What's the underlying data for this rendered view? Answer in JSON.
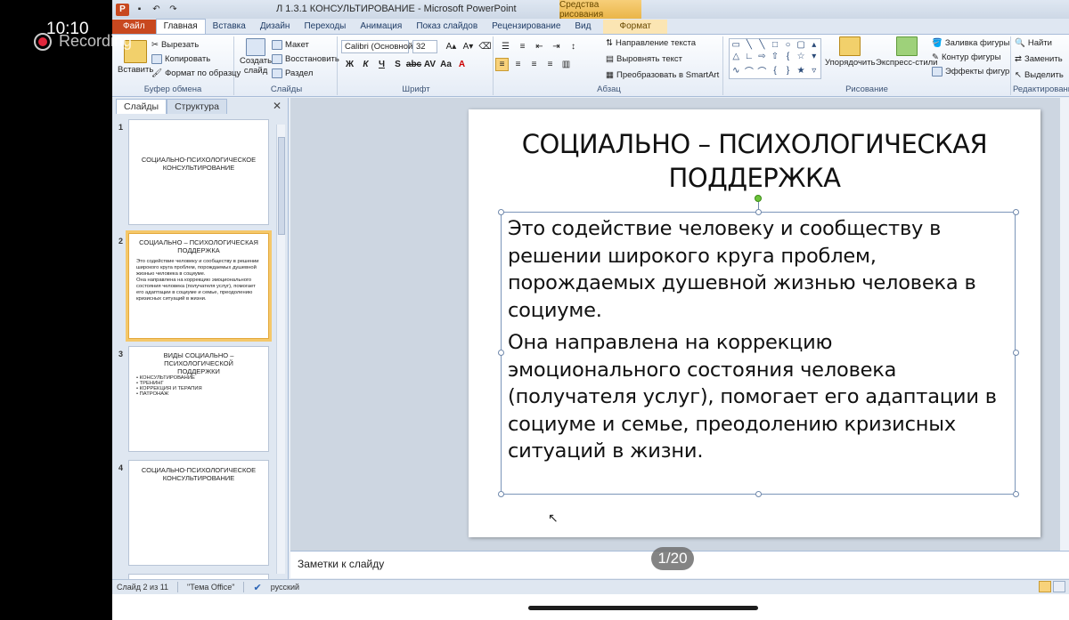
{
  "overlay": {
    "time": "10:10",
    "recording_label": "Recording",
    "page_counter": "1/20"
  },
  "window": {
    "title": "Л 1.3.1 КОНСУЛЬТИРОВАНИЕ - Microsoft PowerPoint",
    "contextual_group": "Средства рисования"
  },
  "tabs": {
    "file": "Файл",
    "items": [
      "Главная",
      "Вставка",
      "Дизайн",
      "Переходы",
      "Анимация",
      "Показ слайдов",
      "Рецензирование",
      "Вид"
    ],
    "format": "Формат"
  },
  "ribbon": {
    "clipboard": {
      "paste": "Вставить",
      "cut": "Вырезать",
      "copy": "Копировать",
      "format_painter": "Формат по образцу",
      "label": "Буфер обмена"
    },
    "slides": {
      "new_slide_1": "Создать",
      "new_slide_2": "слайд",
      "layout": "Макет",
      "reset": "Восстановить",
      "section": "Раздел",
      "label": "Слайды"
    },
    "font": {
      "name": "Calibri (Основной",
      "size": "32",
      "label": "Шрифт"
    },
    "paragraph": {
      "text_direction": "Направление текста",
      "align_text": "Выровнять текст",
      "convert_smartart": "Преобразовать в SmartArt",
      "label": "Абзац"
    },
    "drawing": {
      "arrange": "Упорядочить",
      "quick_styles": "Экспресс-стили",
      "shape_fill": "Заливка фигуры",
      "shape_outline": "Контур фигуры",
      "shape_effects": "Эффекты фигур",
      "label": "Рисование"
    },
    "editing": {
      "find": "Найти",
      "replace": "Заменить",
      "select": "Выделить",
      "label": "Редактирование"
    }
  },
  "side_panel": {
    "tab_slides": "Слайды",
    "tab_outline": "Структура",
    "thumbs": [
      {
        "num": "1",
        "title": "СОЦИАЛЬНО-ПСИХОЛОГИЧЕСКОЕ КОНСУЛЬТИРОВАНИЕ"
      },
      {
        "num": "2",
        "title": "СОЦИАЛЬНО – ПСИХОЛОГИЧЕСКАЯ ПОДДЕРЖКА",
        "p1": "Это содействие человеку и сообществу в решении широкого круга проблем, порождаемых душевной жизнью человека в социуме.",
        "p2": "Она направлена на коррекцию эмоционального состояния человека (получателя услуг), помогает его адаптации в социуме и семье, преодолению кризисных ситуаций в жизни."
      },
      {
        "num": "3",
        "title": "ВИДЫ СОЦИАЛЬНО – ПСИХОЛОГИЧЕСКОЙ ПОДДЕРЖКИ",
        "bullets": [
          "КОНСУЛЬТИРОВАНИЕ",
          "ТРЕНИНГ",
          "КОРРЕКЦИЯ И ТЕРАПИЯ",
          "ПАТРОНАЖ"
        ]
      },
      {
        "num": "4",
        "title": "СОЦИАЛЬНО-ПСИХОЛОГИЧЕСКОЕ КОНСУЛЬТИРОВАНИЕ"
      }
    ]
  },
  "slide": {
    "title": "СОЦИАЛЬНО – ПСИХОЛОГИЧЕСКАЯ ПОДДЕРЖКА",
    "paragraph_1": "Это содействие человеку и сообществу в решении широкого круга проблем, порождаемых душевной жизнью человека в социуме.",
    "paragraph_2": "Она направлена на коррекцию эмоционального состояния человека (получателя услуг), помогает его адаптации в социуме и семье, преодолению кризисных ситуаций в жизни."
  },
  "notes_placeholder": "Заметки к слайду",
  "status": {
    "slide_info": "Слайд 2 из 11",
    "theme": "\"Тема Office\"",
    "language": "русский"
  }
}
